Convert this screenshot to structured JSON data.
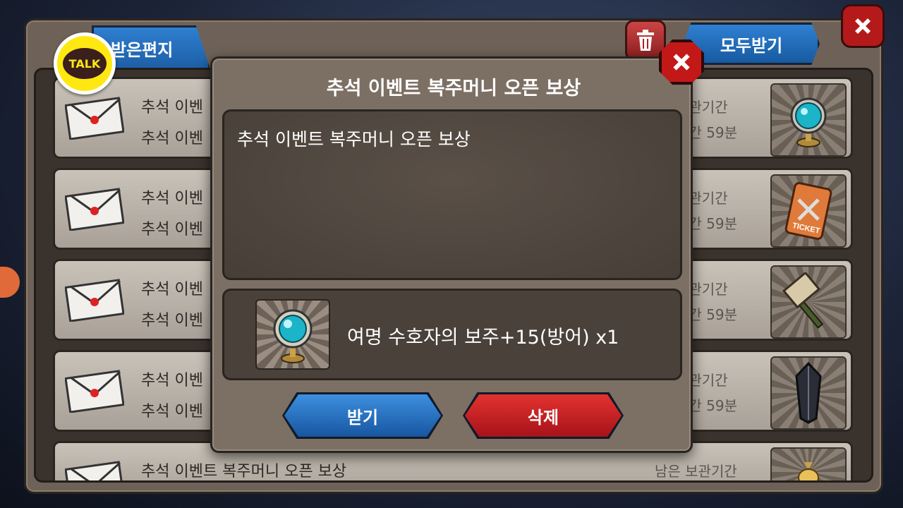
{
  "mailbox": {
    "tab_label": "받은편지",
    "receive_all_label": "모두받기",
    "talk_label": "TALK",
    "rows": [
      {
        "title": "추석 이벤",
        "subtitle": "추석 이벤",
        "keep": "보관기간",
        "time": "시간 59분",
        "item_icon": "crystal-orb-icon"
      },
      {
        "title": "추석 이벤",
        "subtitle": "추석 이벤",
        "keep": "보관기간",
        "time": "시간 59분",
        "item_icon": "ticket-icon"
      },
      {
        "title": "추석 이벤",
        "subtitle": "추석 이벤",
        "keep": "보관기간",
        "time": "시간 59분",
        "item_icon": "hammer-icon"
      },
      {
        "title": "추석 이벤",
        "subtitle": "추석 이벤",
        "keep": "보관기간",
        "time": "시간 59분",
        "item_icon": "dark-crystal-icon"
      },
      {
        "title": "추석 이벤트 복주머니 오픈 보상",
        "subtitle": "",
        "keep": "남은 보관기간",
        "time": "",
        "item_icon": "pouch-icon"
      }
    ]
  },
  "dialog": {
    "title": "추석 이벤트 복주머니 오픈 보상",
    "message": "추석 이벤트 복주머니 오픈 보상",
    "reward_text": "여명 수호자의 보주+15(방어) x1",
    "receive_label": "받기",
    "delete_label": "삭제"
  },
  "colors": {
    "blue_button": "#1f6fc0",
    "red_button": "#c41a1f",
    "panel": "#7c6f64",
    "talk_yellow": "#ffe812"
  }
}
